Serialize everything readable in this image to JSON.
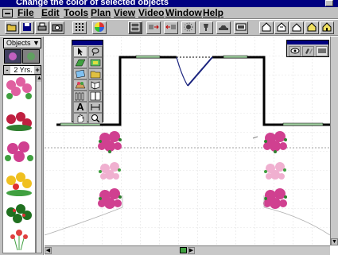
{
  "window": {
    "title": "Change the color of selected objects"
  },
  "menu": [
    {
      "label": "File"
    },
    {
      "label": "Edit"
    },
    {
      "label": "Tools"
    },
    {
      "label": "Plan"
    },
    {
      "label": "View"
    },
    {
      "label": "Video"
    },
    {
      "label": "Window"
    },
    {
      "label": "Help"
    }
  ],
  "toolbar": {
    "buttons": [
      "open-icon",
      "save-icon",
      "print-icon",
      "camera-icon",
      "grid-icon",
      "color-wheel-icon",
      "plan-view-icon",
      "move-right-icon",
      "move-left-icon",
      "sun-icon",
      "light-icon",
      "car-icon",
      "video-icon",
      "house-1-icon",
      "house-2-icon",
      "house-3-icon",
      "house-4-icon",
      "house-5-icon"
    ]
  },
  "objects_panel": {
    "objects_label": "Objects",
    "age_value": "2 Yrs.",
    "minus": "-",
    "plus": "+",
    "plants": [
      "pink-flower-bush",
      "red-flower-bush",
      "magenta-flower-bush",
      "yellow-flower-bush",
      "green-shrub",
      "red-tall-flower"
    ]
  },
  "tool_palette": {
    "tools": [
      "arrow-tool",
      "lasso-tool",
      "hedge-tool",
      "tree-tool",
      "path-tool",
      "bed-tool",
      "planter-tool",
      "wall-tool",
      "fence-tool",
      "gate-tool",
      "text-tool",
      "dimension-tool",
      "hand-tool",
      "zoom-tool"
    ],
    "text_glyph": "A"
  },
  "colors": {
    "title_bar": "#000080",
    "chrome": "#c0c0c0",
    "wall": "#000000",
    "window_glass": "#a0d0a0",
    "door": "#1a237e"
  }
}
